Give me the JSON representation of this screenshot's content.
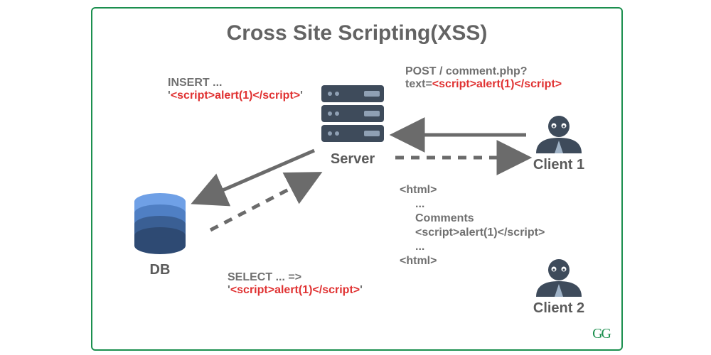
{
  "title": "Cross Site Scripting(XSS)",
  "payload_string": "<script>alert(1)</script>",
  "nodes": {
    "db": {
      "caption": "DB"
    },
    "server": {
      "caption": "Server"
    },
    "client1": {
      "caption": "Client 1"
    },
    "client2": {
      "caption": "Client 2"
    }
  },
  "edges": {
    "client1_to_server": {
      "line1": "POST / comment.php?",
      "line2_prefix": "text="
    },
    "server_to_db": {
      "line1": "INSERT ...",
      "line2_prefix": "'",
      "line2_suffix": "'"
    },
    "db_to_server": {
      "line1": "SELECT ... =>",
      "line2_prefix": "'",
      "line2_suffix": "'"
    },
    "server_to_client2": {
      "html_open": "<html>",
      "ellipsis": "...",
      "comments": "Comments",
      "html_close": "<html>"
    }
  },
  "watermark": "GG"
}
